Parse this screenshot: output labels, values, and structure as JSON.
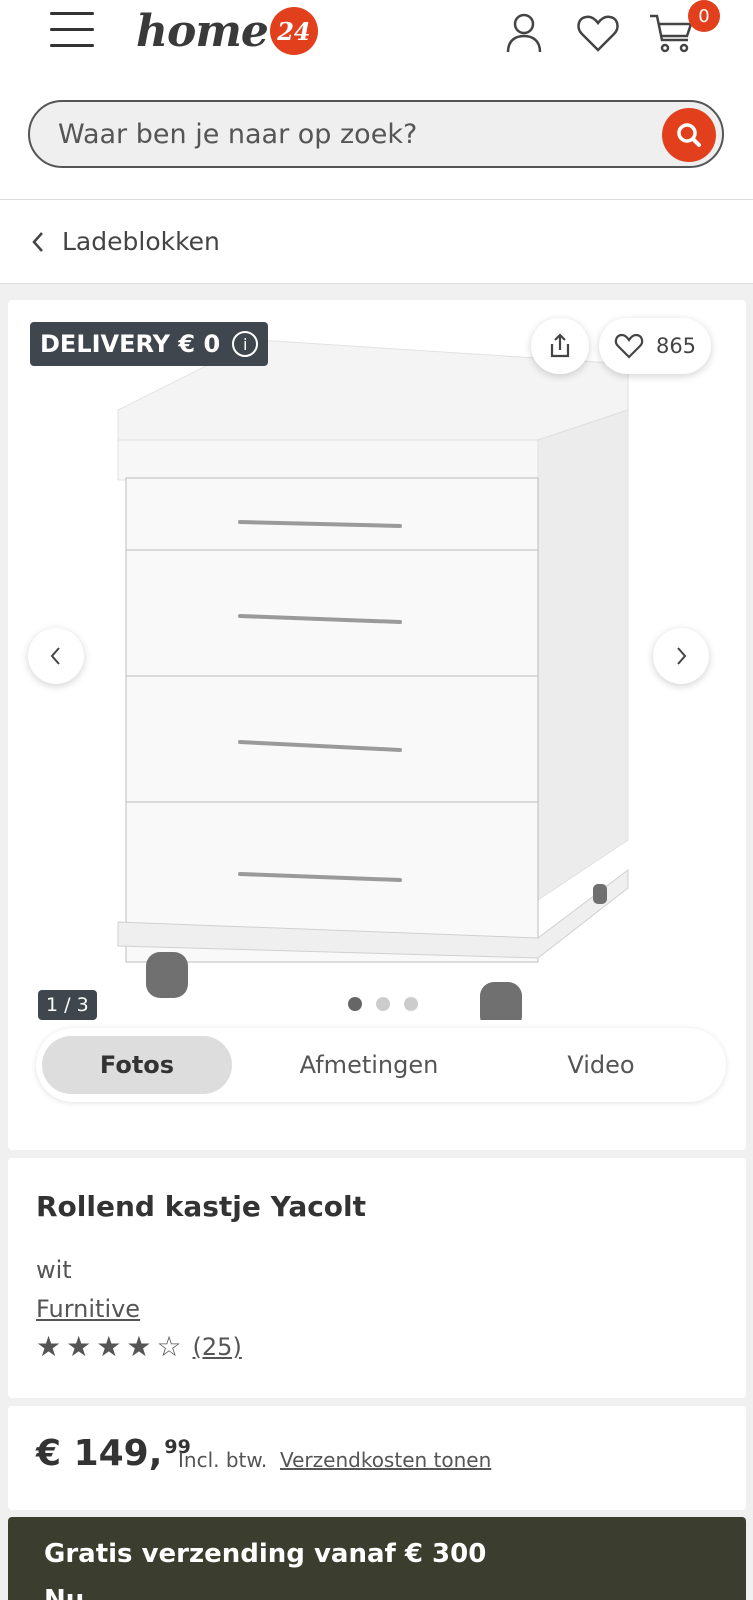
{
  "header": {
    "logo_text": "home",
    "logo_badge": "24",
    "cart_count": "0",
    "search_placeholder": "Waar ben je naar op zoek?"
  },
  "breadcrumb": {
    "label": "Ladeblokken"
  },
  "gallery": {
    "delivery_label": "DELIVERY € 0",
    "info_symbol": "i",
    "wishlist_count": "865",
    "image_counter": "1 / 3",
    "tabs": [
      {
        "label": "Fotos",
        "active": true
      },
      {
        "label": "Afmetingen",
        "active": false
      },
      {
        "label": "Video",
        "active": false
      }
    ]
  },
  "product": {
    "title": "Rollend kastje Yacolt",
    "color": "wit",
    "brand": "Furnitive",
    "rating": 4,
    "rating_max": 5,
    "review_count": "(25)"
  },
  "price": {
    "currency_main": "€ 149,",
    "cents": "99",
    "vat_label": "Incl. btw.",
    "shipping_link": "Verzendkosten tonen"
  },
  "banner": {
    "title": "Gratis verzending vanaf € 300",
    "subtitle": "Nu"
  },
  "colors": {
    "accent": "#e2401c",
    "dark_badge": "#3f464d",
    "banner_bg": "#3b3d2e"
  }
}
